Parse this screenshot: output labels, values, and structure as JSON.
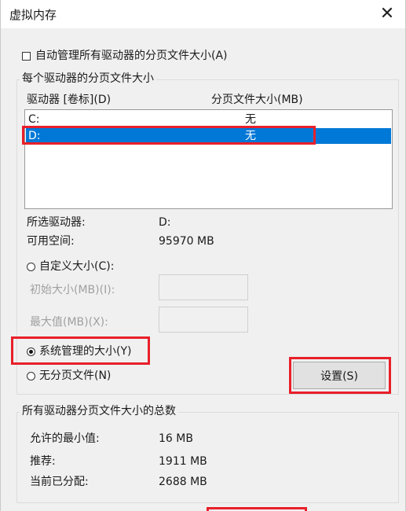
{
  "window": {
    "title": "虚拟内存",
    "close_glyph": "✕"
  },
  "auto_manage": {
    "label": "自动管理所有驱动器的分页文件大小(A)",
    "checked": false
  },
  "per_drive": {
    "group_label": "每个驱动器的分页文件大小",
    "columns": {
      "drive": "驱动器 [卷标](D)",
      "size": "分页文件大小(MB)"
    },
    "drives": [
      {
        "letter": "C:",
        "size": "无"
      },
      {
        "letter": "D:",
        "size": "无"
      }
    ],
    "selected_index": 1,
    "selected_drive_label": "所选驱动器:",
    "selected_drive_value": "D:",
    "free_space_label": "可用空间:",
    "free_space_value": "95970 MB",
    "custom_size_label": "自定义大小(C):",
    "initial_size_label": "初始大小(MB)(I):",
    "max_size_label": "最大值(MB)(X):",
    "system_managed_label": "系统管理的大小(Y)",
    "no_paging_label": "无分页文件(N)",
    "selected_option": "system_managed",
    "set_button_label": "设置(S)"
  },
  "totals": {
    "group_label": "所有驱动器分页文件大小的总数",
    "min_label": "允许的最小值:",
    "min_value": "16 MB",
    "recommended_label": "推荐:",
    "recommended_value": "1911 MB",
    "allocated_label": "当前已分配:",
    "allocated_value": "2688 MB"
  },
  "colors": {
    "selection": "#0078d7",
    "annotation_red": "#e8202a"
  }
}
